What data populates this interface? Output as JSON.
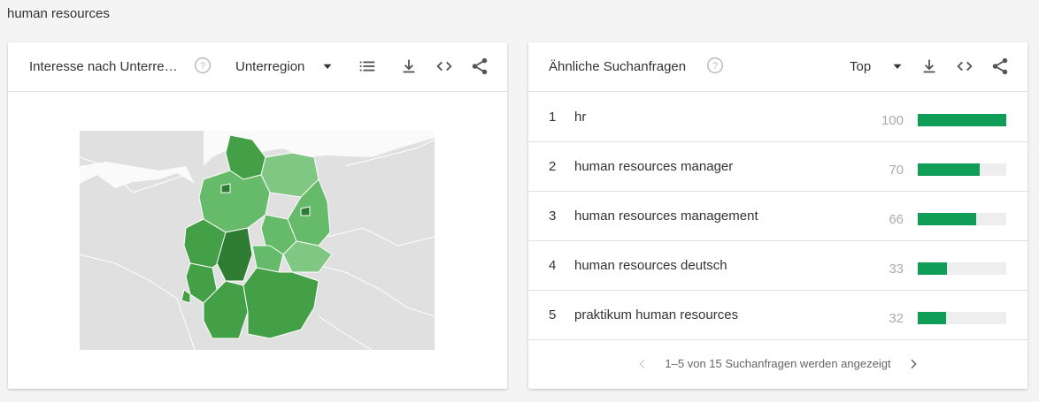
{
  "search_term": "human resources",
  "left_card": {
    "title": "Interesse nach Unterre…",
    "resolution_select": "Unterregion",
    "icons": [
      "help-icon",
      "chevron-down-icon",
      "list-icon",
      "download-icon",
      "embed-icon",
      "share-icon"
    ]
  },
  "right_card": {
    "title": "Ähnliche Suchanfragen",
    "sort_select": "Top",
    "icons": [
      "help-icon",
      "chevron-down-icon",
      "download-icon",
      "embed-icon",
      "share-icon"
    ],
    "rows": [
      {
        "rank": "1",
        "query": "hr",
        "value": "100",
        "bar": 100
      },
      {
        "rank": "2",
        "query": "human resources manager",
        "value": "70",
        "bar": 70
      },
      {
        "rank": "3",
        "query": "human resources management",
        "value": "66",
        "bar": 66
      },
      {
        "rank": "4",
        "query": "human resources deutsch",
        "value": "33",
        "bar": 33
      },
      {
        "rank": "5",
        "query": "praktikum human resources",
        "value": "32",
        "bar": 32
      }
    ],
    "pager_text": "1–5 von 15 Suchanfragen werden angezeigt"
  },
  "colors": {
    "bar_fill": "#0f9d58",
    "bar_bg": "#eeeeee",
    "map_background": "#e0e0e0",
    "map_dark": "#2e7d32",
    "map_mid": "#43a047",
    "map_light": "#66bb6a",
    "map_lighter": "#81c784"
  }
}
